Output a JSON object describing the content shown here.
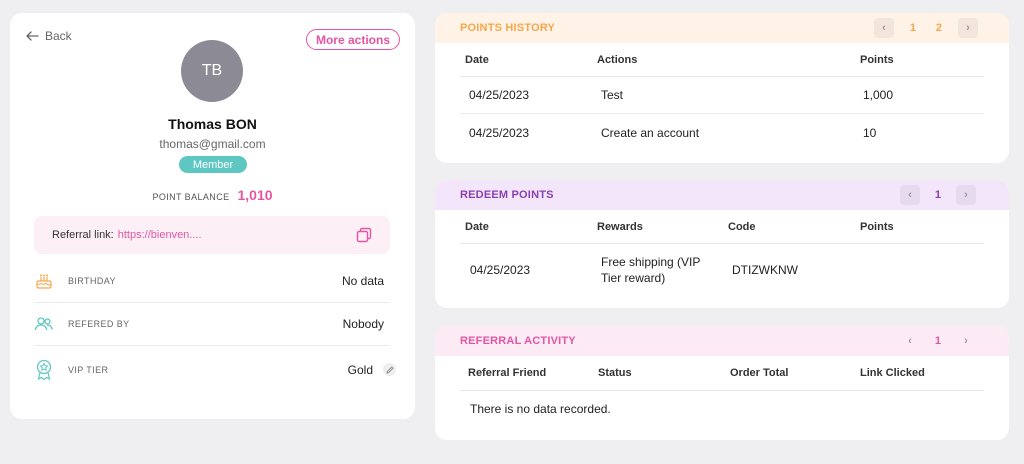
{
  "profile": {
    "back_label": "Back",
    "more_actions_label": "More actions",
    "initials": "TB",
    "name": "Thomas BON",
    "email": "thomas@gmail.com",
    "badge": "Member",
    "point_balance_label": "POINT BALANCE",
    "point_balance_value": "1,010",
    "referral_label": "Referral link:",
    "referral_link": "https://bienven....",
    "rows": [
      {
        "label": "BIRTHDAY",
        "value": "No data",
        "icon": "birthday-cake-icon"
      },
      {
        "label": "REFERED BY",
        "value": "Nobody",
        "icon": "users-icon"
      },
      {
        "label": "VIP TIER",
        "value": "Gold",
        "icon": "award-icon"
      }
    ]
  },
  "points_history": {
    "title": "POINTS HISTORY",
    "pages": [
      "1",
      "2"
    ],
    "active_page": "2",
    "columns": [
      "Date",
      "Actions",
      "Points"
    ],
    "rows": [
      [
        "04/25/2023",
        "Test",
        "1,000"
      ],
      [
        "04/25/2023",
        "Create an account",
        "10"
      ]
    ]
  },
  "redeem_points": {
    "title": "REDEEM POINTS",
    "pages": [
      "1"
    ],
    "active_page": "1",
    "columns": [
      "Date",
      "Rewards",
      "Code",
      "Points"
    ],
    "rows": [
      [
        "04/25/2023",
        "Free shipping (VIP Tier reward)",
        "DTIZWKNW",
        ""
      ]
    ]
  },
  "referral_activity": {
    "title": "REFERRAL ACTIVITY",
    "pages": [
      "1"
    ],
    "active_page": "1",
    "columns": [
      "Referral Friend",
      "Status",
      "Order Total",
      "Link Clicked"
    ],
    "empty_text": "There is no data recorded."
  },
  "colors": {
    "accent_pink": "#e455a2",
    "teal_badge": "#5ec7c1",
    "orange_header_bg": "#fff3e8",
    "orange_header_text": "#f5a64a",
    "purple_header_bg": "#f3e6fb",
    "purple_header_text": "#8a3fb3",
    "pink_header_bg": "#fcebf5",
    "pink_header_text": "#e455a2"
  }
}
